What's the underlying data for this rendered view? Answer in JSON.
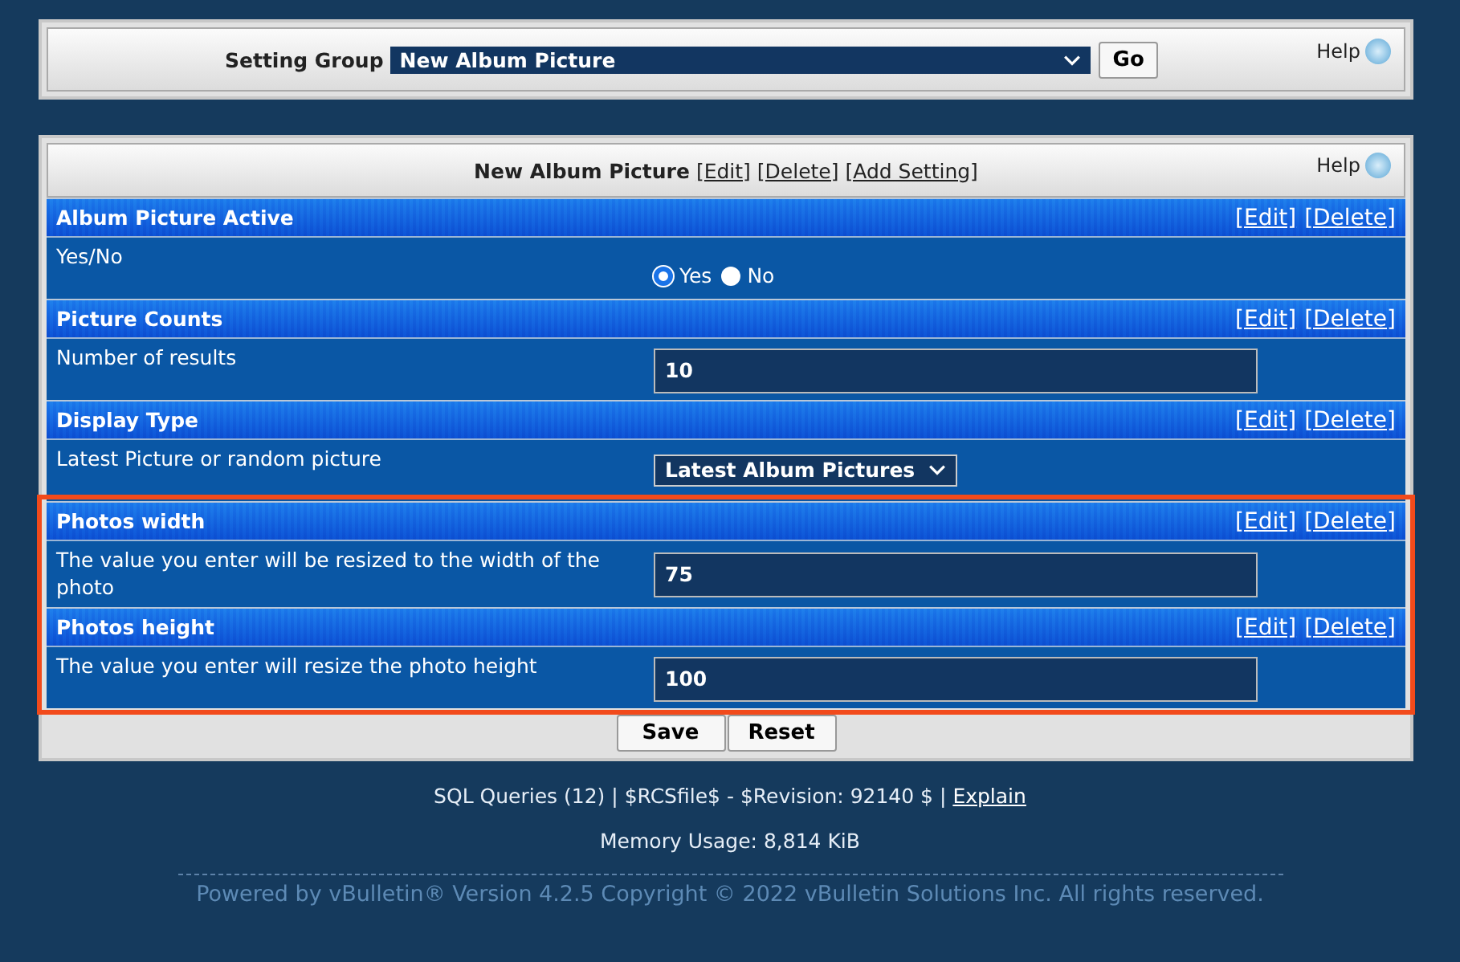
{
  "setting_group": {
    "label": "Setting Group",
    "value": "New Album Picture",
    "button": "Go",
    "help": "Help"
  },
  "panel": {
    "title": "New Album Picture",
    "links": [
      "[Edit]",
      "[Delete]",
      "[Add Setting]"
    ],
    "help": "Help",
    "settings": [
      {
        "title": "Album Picture Active",
        "links": [
          "[Edit]",
          "[Delete]"
        ],
        "description": "Yes/No",
        "kind": "radio",
        "highlighted": false,
        "options": [
          {
            "label": "Yes",
            "selected": true
          },
          {
            "label": "No",
            "selected": false
          }
        ]
      },
      {
        "title": "Picture Counts",
        "links": [
          "[Edit]",
          "[Delete]"
        ],
        "description": "Number of results",
        "kind": "text",
        "highlighted": false,
        "value": "10"
      },
      {
        "title": "Display Type",
        "links": [
          "[Edit]",
          "[Delete]"
        ],
        "description": "Latest Picture or random picture",
        "kind": "select",
        "highlighted": false,
        "value": "Latest Album Pictures"
      },
      {
        "title": "Photos width",
        "links": [
          "[Edit]",
          "[Delete]"
        ],
        "description": "The value you enter will be resized to the width of the photo",
        "kind": "text",
        "highlighted": true,
        "value": "75"
      },
      {
        "title": "Photos height",
        "links": [
          "[Edit]",
          "[Delete]"
        ],
        "description": "The value you enter will resize the photo height",
        "kind": "text",
        "highlighted": true,
        "value": "100"
      }
    ],
    "buttons": [
      "Save",
      "Reset"
    ]
  },
  "footer": {
    "queries": "SQL Queries (12) | $RCSfile$ - $Revision: 92140 $ |",
    "explain": "Explain",
    "memory": "Memory Usage: 8,814 KiB",
    "copyright": "Powered by vBulletin® Version 4.2.5 Copyright © 2022 vBulletin Solutions Inc. All rights reserved."
  }
}
